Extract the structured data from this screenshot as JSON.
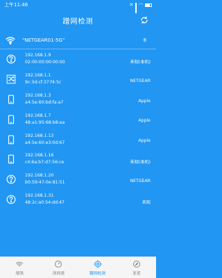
{
  "status_bar": {
    "time": "上午11:46"
  },
  "header": {
    "title": "蹭网检测",
    "refresh_icon": "refresh-icon"
  },
  "network": {
    "ssid": "\"NETGEAR01-5G\"",
    "device_count": "8",
    "icon": "wifi-icon"
  },
  "devices": [
    {
      "icon": "unknown-device-icon",
      "ip": "192.168.1.9",
      "mac": "02:00:00:00:00:00",
      "vendor": "未知(本机)"
    },
    {
      "icon": "router-icon",
      "ip": "192.168.1.1",
      "mac": "9c:3d:cf:37:f4:5c",
      "vendor": "NETGEAR"
    },
    {
      "icon": "phone-icon",
      "ip": "192.168.1.3",
      "mac": "a4:5e:60:bd:fa:a7",
      "vendor": "Apple"
    },
    {
      "icon": "phone-icon",
      "ip": "192.168.1.7",
      "mac": "48:a1:95:68:b8:ea",
      "vendor": "Apple"
    },
    {
      "icon": "phone-icon",
      "ip": "192.168.1.13",
      "mac": "a4:5e:60:e3:0d:67",
      "vendor": "Apple"
    },
    {
      "icon": "phone-icon",
      "ip": "192.168.1.16",
      "mac": "c4:6a:b7:d7:56:ce",
      "vendor": "未知(本机)"
    },
    {
      "icon": "unknown-device-icon",
      "ip": "192.168.1.20",
      "mac": "b0:59:47:0e:81:51",
      "vendor": "NETGEAR"
    },
    {
      "icon": "unknown-device-icon",
      "ip": "192.168.1.31",
      "mac": "48:2c:a0:54:dd:47",
      "vendor": "未知"
    }
  ],
  "bottom_nav": [
    {
      "label": "增强",
      "icon": "wifi-boost-icon",
      "active": false
    },
    {
      "label": "测网速",
      "icon": "speedometer-icon",
      "active": false
    },
    {
      "label": "蹭网检测",
      "icon": "target-icon",
      "active": true
    },
    {
      "label": "发现",
      "icon": "compass-icon",
      "active": false
    }
  ],
  "colors": {
    "primary": "#2196f3",
    "nav_bg": "#f5f5f5",
    "inactive": "#888888"
  }
}
